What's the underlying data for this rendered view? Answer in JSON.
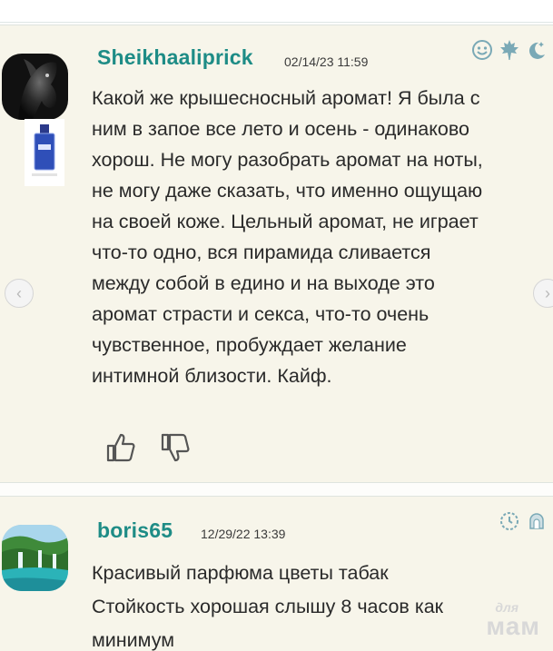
{
  "comments": [
    {
      "username": "Sheikhaaliprick",
      "date": "02/14/23 11:59",
      "text_lines": [
        "Какой же крышесносный аромат! Я была с",
        "ним в запое все лето и осень - одинаково",
        "хорош. Не могу разобрать аромат на ноты,",
        "не могу даже сказать, что именно ощущаю",
        "на своей коже. Цельный аромат, не играет",
        "что-то одно, вся пирамида сливается",
        "между собой в едино и на выходе это",
        "аромат страсти и секса, что-то очень",
        "чувственное, пробуждает желание",
        "интимной близости. Кайф."
      ],
      "icons": [
        "smile-icon",
        "maple-leaf-icon",
        "moon-stars-icon"
      ]
    },
    {
      "username": "boris65",
      "date": "12/29/22 13:39",
      "text_lines": [
        "Красивый парфюма цветы табак",
        "Стойкость хорошая слышу 8 часов как",
        "минимум"
      ],
      "icons": [
        "clock-icon",
        "arch-icon"
      ]
    }
  ],
  "nav": {
    "prev": "‹",
    "next": "›"
  },
  "watermark": {
    "small": "для",
    "big": "мам"
  },
  "colors": {
    "username": "#1e8c86",
    "card_bg": "#f7f5ea",
    "icon": "#7aa9b6"
  }
}
